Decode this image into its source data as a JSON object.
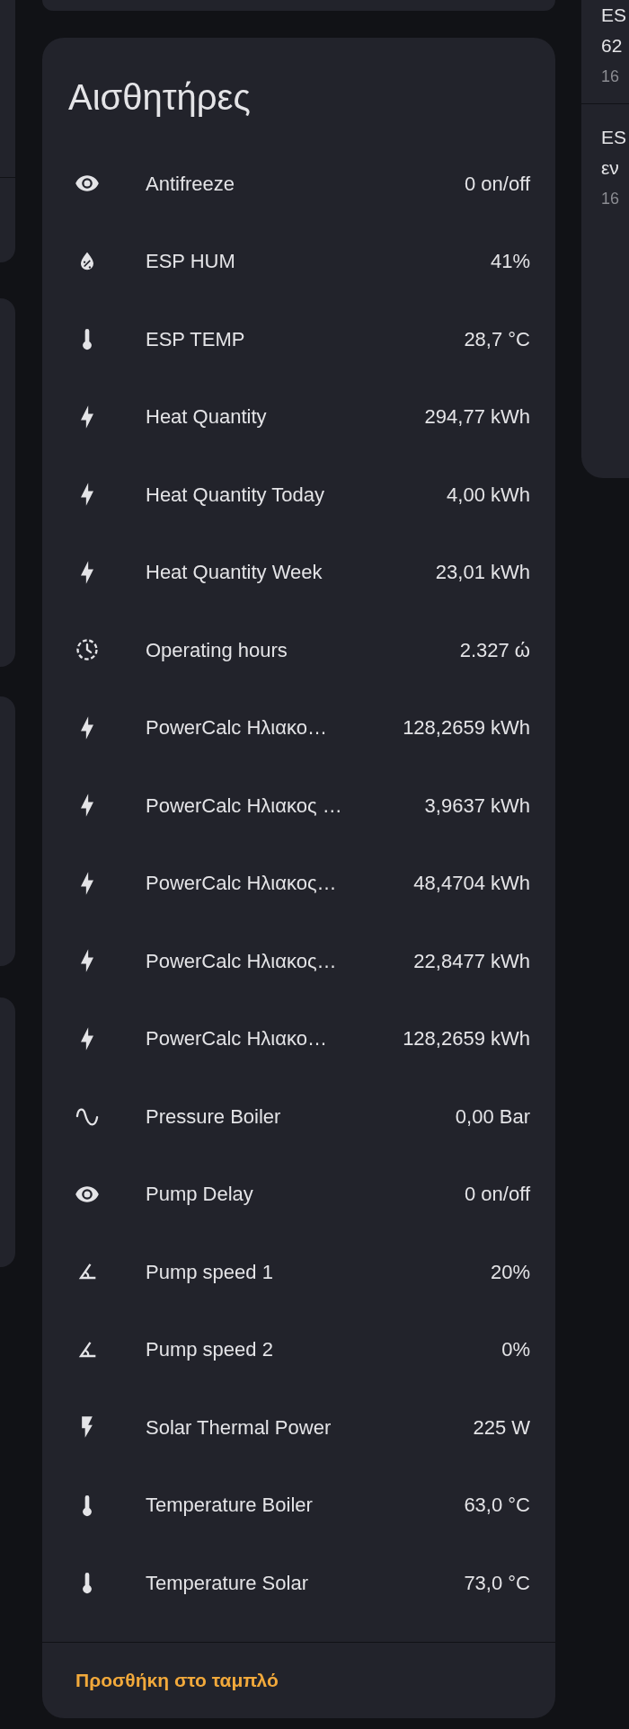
{
  "card": {
    "title": "Αισθητήρες",
    "rows": [
      {
        "kind": "binary",
        "name": "Antifreeze",
        "value": "0 on/off"
      },
      {
        "kind": "humidity",
        "name": "ESP HUM",
        "value": "41%"
      },
      {
        "kind": "temperature",
        "name": "ESP TEMP",
        "value": "28,7 °C"
      },
      {
        "kind": "energy",
        "name": "Heat Quantity",
        "value": "294,77 kWh"
      },
      {
        "kind": "energy",
        "name": "Heat Quantity Today",
        "value": "4,00 kWh"
      },
      {
        "kind": "energy",
        "name": "Heat Quantity Week",
        "value": "23,01 kWh"
      },
      {
        "kind": "duration",
        "name": "Operating hours",
        "value": "2.327 ώ"
      },
      {
        "kind": "energy",
        "name": "PowerCalc Ηλιακο…",
        "value": "128,2659 kWh"
      },
      {
        "kind": "energy",
        "name": "PowerCalc Ηλιακος …",
        "value": "3,9637 kWh"
      },
      {
        "kind": "energy",
        "name": "PowerCalc Ηλιακος…",
        "value": "48,4704 kWh"
      },
      {
        "kind": "energy",
        "name": "PowerCalc Ηλιακος…",
        "value": "22,8477 kWh"
      },
      {
        "kind": "energy",
        "name": "PowerCalc Ηλιακο…",
        "value": "128,2659 kWh"
      },
      {
        "kind": "pressure",
        "name": "Pressure Boiler",
        "value": "0,00 Bar"
      },
      {
        "kind": "binary",
        "name": "Pump Delay",
        "value": "0 on/off"
      },
      {
        "kind": "percent",
        "name": "Pump speed 1",
        "value": "20%"
      },
      {
        "kind": "percent",
        "name": "Pump speed 2",
        "value": "0%"
      },
      {
        "kind": "power",
        "name": "Solar Thermal Power",
        "value": "225 W"
      },
      {
        "kind": "temperature",
        "name": "Temperature Boiler",
        "value": "63,0 °C"
      },
      {
        "kind": "temperature",
        "name": "Temperature Solar",
        "value": "73,0 °C"
      }
    ],
    "footer_link": "Προσθήκη στο ταμπλό"
  },
  "right_column": {
    "items": [
      {
        "line_1": "ES",
        "line_2": "62",
        "line_3": "16"
      },
      {
        "line_1": "ES",
        "line_2": "εν",
        "line_3": "16"
      }
    ]
  }
}
